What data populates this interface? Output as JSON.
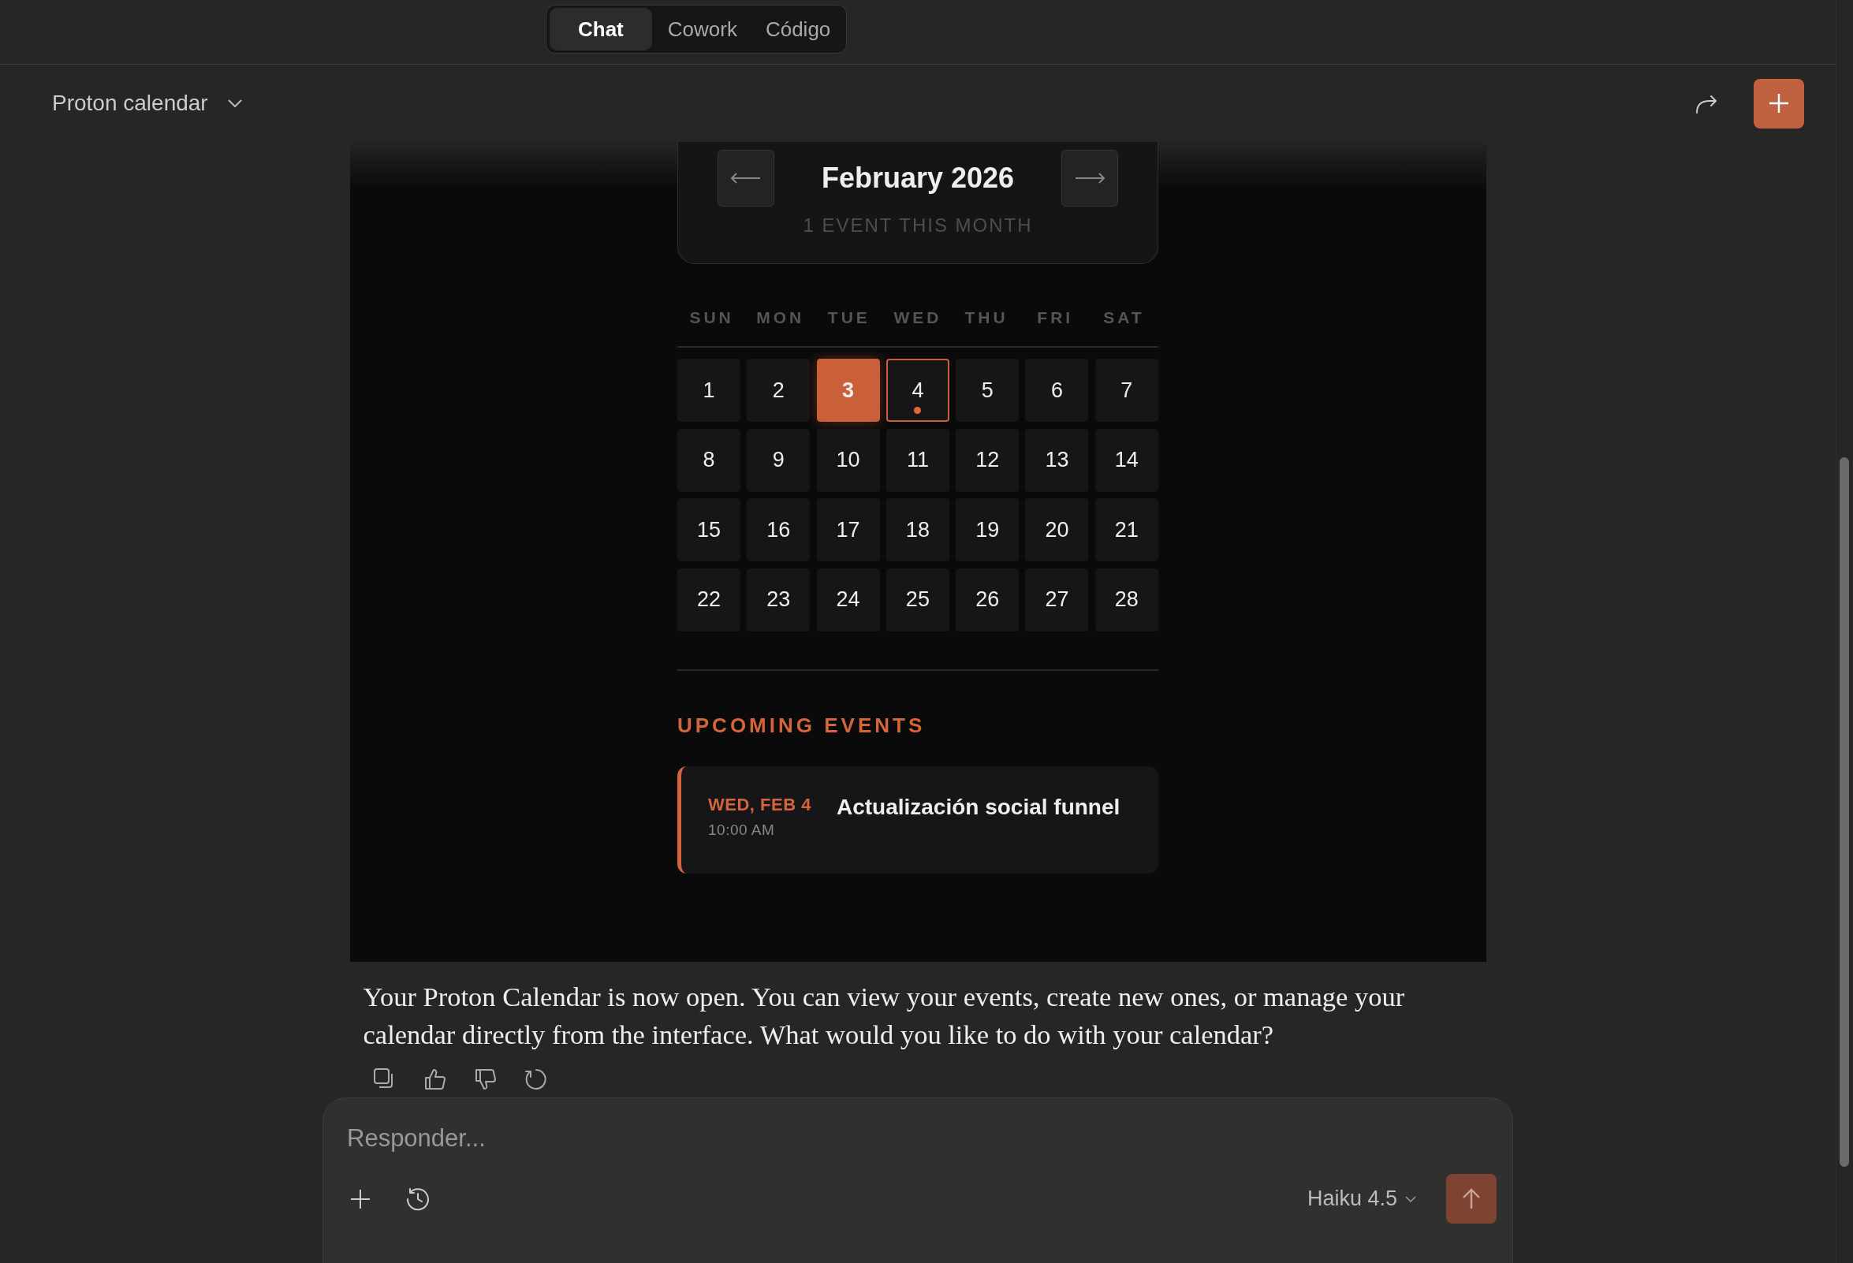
{
  "mode_tabs": [
    {
      "label": "Chat",
      "selected": true
    },
    {
      "label": "Cowork",
      "selected": false
    },
    {
      "label": "Código",
      "selected": false
    }
  ],
  "conversation": {
    "title": "Proton calendar"
  },
  "calendar": {
    "month": "February 2026",
    "summary": "1 EVENT THIS MONTH",
    "weekdays": [
      "SUN",
      "MON",
      "TUE",
      "WED",
      "THU",
      "FRI",
      "SAT"
    ],
    "days": [
      {
        "label": "1",
        "today": false,
        "selected": false,
        "has_event": false
      },
      {
        "label": "2",
        "today": false,
        "selected": false,
        "has_event": false
      },
      {
        "label": "3",
        "today": true,
        "selected": false,
        "has_event": false
      },
      {
        "label": "4",
        "today": false,
        "selected": true,
        "has_event": true
      },
      {
        "label": "5",
        "today": false,
        "selected": false,
        "has_event": false
      },
      {
        "label": "6",
        "today": false,
        "selected": false,
        "has_event": false
      },
      {
        "label": "7",
        "today": false,
        "selected": false,
        "has_event": false
      },
      {
        "label": "8",
        "today": false,
        "selected": false,
        "has_event": false
      },
      {
        "label": "9",
        "today": false,
        "selected": false,
        "has_event": false
      },
      {
        "label": "10",
        "today": false,
        "selected": false,
        "has_event": false
      },
      {
        "label": "11",
        "today": false,
        "selected": false,
        "has_event": false
      },
      {
        "label": "12",
        "today": false,
        "selected": false,
        "has_event": false
      },
      {
        "label": "13",
        "today": false,
        "selected": false,
        "has_event": false
      },
      {
        "label": "14",
        "today": false,
        "selected": false,
        "has_event": false
      },
      {
        "label": "15",
        "today": false,
        "selected": false,
        "has_event": false
      },
      {
        "label": "16",
        "today": false,
        "selected": false,
        "has_event": false
      },
      {
        "label": "17",
        "today": false,
        "selected": false,
        "has_event": false
      },
      {
        "label": "18",
        "today": false,
        "selected": false,
        "has_event": false
      },
      {
        "label": "19",
        "today": false,
        "selected": false,
        "has_event": false
      },
      {
        "label": "20",
        "today": false,
        "selected": false,
        "has_event": false
      },
      {
        "label": "21",
        "today": false,
        "selected": false,
        "has_event": false
      },
      {
        "label": "22",
        "today": false,
        "selected": false,
        "has_event": false
      },
      {
        "label": "23",
        "today": false,
        "selected": false,
        "has_event": false
      },
      {
        "label": "24",
        "today": false,
        "selected": false,
        "has_event": false
      },
      {
        "label": "25",
        "today": false,
        "selected": false,
        "has_event": false
      },
      {
        "label": "26",
        "today": false,
        "selected": false,
        "has_event": false
      },
      {
        "label": "27",
        "today": false,
        "selected": false,
        "has_event": false
      },
      {
        "label": "28",
        "today": false,
        "selected": false,
        "has_event": false
      }
    ],
    "upcoming_heading": "UPCOMING EVENTS",
    "events": [
      {
        "date": "WED, FEB 4",
        "time": "10:00 AM",
        "title": "Actualización social funnel"
      }
    ]
  },
  "message": {
    "text": "Your Proton Calendar is now open. You can view your events, create new ones, or manage your calendar directly from the interface. What would you like to do with your calendar?"
  },
  "composer": {
    "placeholder": "Responder...",
    "model": "Haiku 4.5"
  }
}
